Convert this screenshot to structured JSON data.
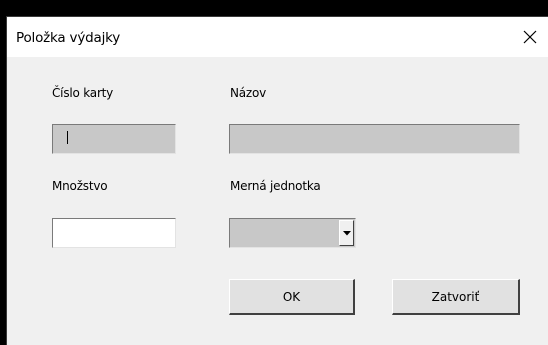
{
  "window": {
    "title": "Položka výdajky",
    "close_icon": "close-x-icon"
  },
  "fields": {
    "card_number": {
      "label": "Číslo karty",
      "value": "",
      "enabled": false
    },
    "name": {
      "label": "Názov",
      "value": "",
      "enabled": false
    },
    "quantity": {
      "label": "Množstvo",
      "value": "",
      "enabled": true
    },
    "unit": {
      "label": "Merná jednotka",
      "selected": "",
      "enabled": false,
      "arrow_icon": "dropdown-arrow-icon"
    }
  },
  "buttons": {
    "ok_label": "OK",
    "close_label": "Zatvoriť"
  }
}
